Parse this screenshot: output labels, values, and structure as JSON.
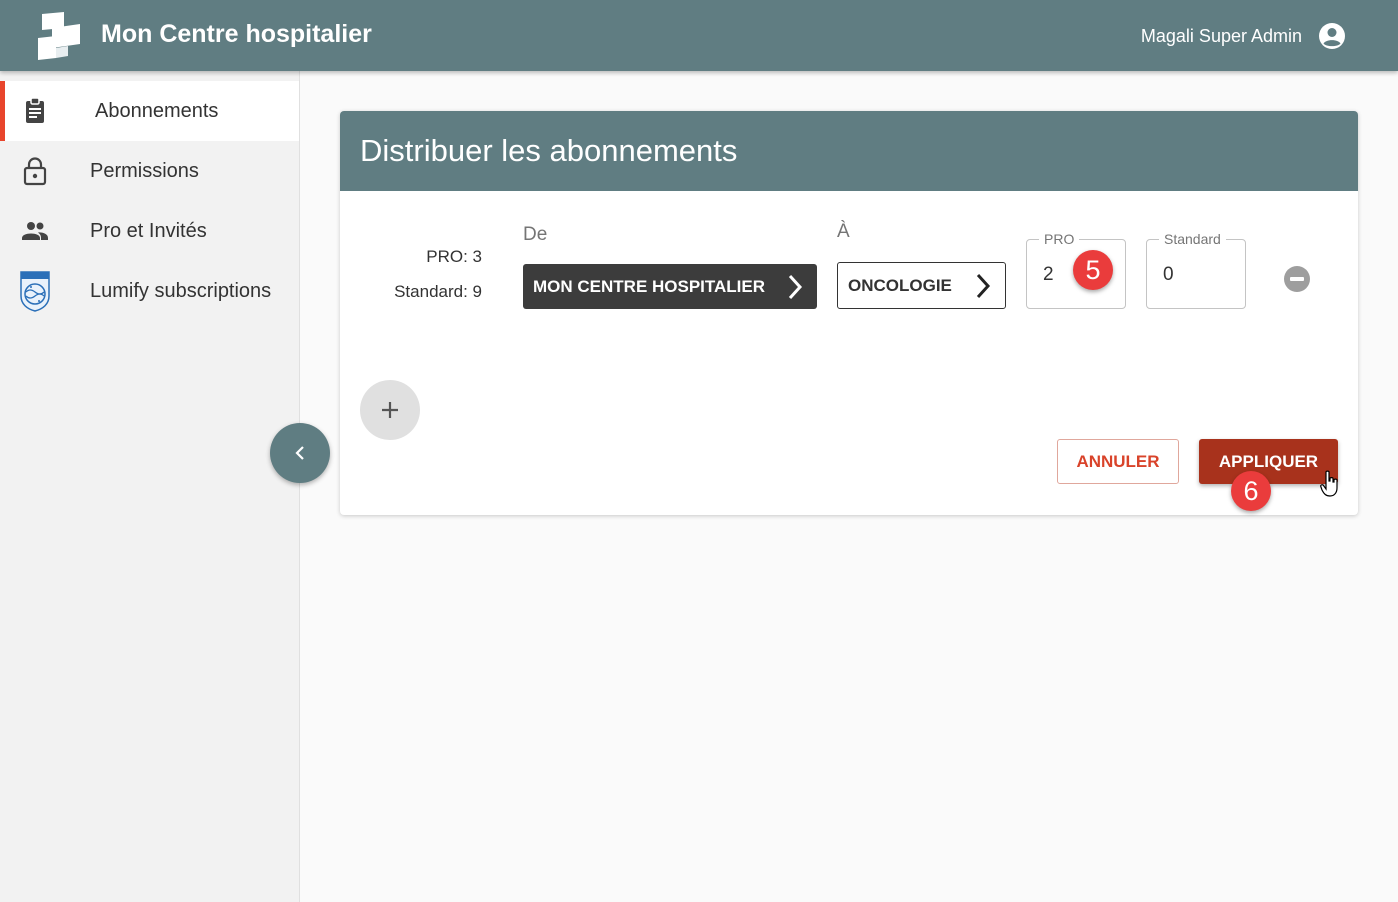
{
  "header": {
    "app_title": "Mon Centre hospitalier",
    "user_name": "Magali Super Admin",
    "logo_icon": "hospital-logo",
    "account_icon": "account-circle-icon",
    "background": "#607d82"
  },
  "sidebar": {
    "items": [
      {
        "label": "Abonnements",
        "icon": "clipboard-icon",
        "active": true
      },
      {
        "label": "Permissions",
        "icon": "lock-icon",
        "active": false
      },
      {
        "label": "Pro et Invités",
        "icon": "people-icon",
        "active": false
      },
      {
        "label": "Lumify subscriptions",
        "icon": "philips-logo",
        "active": false
      }
    ],
    "active_color": "#e8452c",
    "collapse_icon": "chevron-left-icon"
  },
  "card": {
    "title": "Distribuer les abonnements",
    "available": {
      "pro": "PRO: 3",
      "standard": "Standard: 9"
    },
    "from_label": "De",
    "to_label": "À",
    "from_value": "MON CENTRE HOSPITALIER",
    "to_value": "ONCOLOGIE",
    "pro_field": {
      "label": "PRO",
      "value": "2"
    },
    "standard_field": {
      "label": "Standard",
      "value": "0"
    },
    "remove_icon": "remove-circle-icon",
    "add_icon": "plus-icon",
    "cancel_label": "ANNULER",
    "apply_label": "APPLIQUER",
    "apply_color": "#a8321c"
  },
  "annotations": {
    "step5": "5",
    "step6": "6",
    "badge_color": "#ea3c3c"
  }
}
